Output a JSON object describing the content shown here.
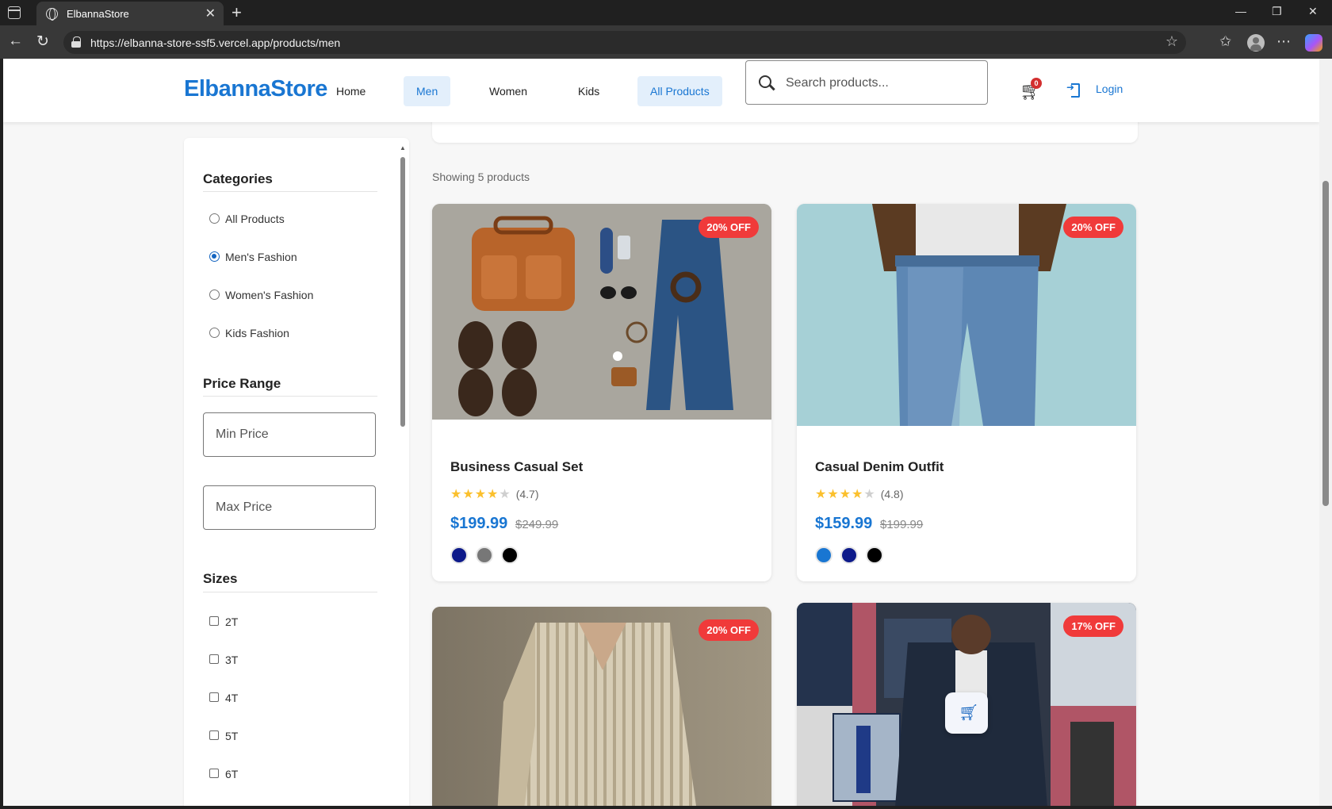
{
  "browser": {
    "tab_title": "ElbannaStore",
    "url": "https://elbanna-store-ssf5.vercel.app/products/men"
  },
  "header": {
    "brand": "ElbannaStore",
    "nav": [
      {
        "label": "Home",
        "active": false
      },
      {
        "label": "Men",
        "active": true
      },
      {
        "label": "Women",
        "active": false
      },
      {
        "label": "Kids",
        "active": false
      },
      {
        "label": "All Products",
        "active": true
      }
    ],
    "search_placeholder": "Search products...",
    "cart_count": "0",
    "login_label": "Login"
  },
  "filters": {
    "categories_title": "Categories",
    "categories": [
      {
        "label": "All Products",
        "selected": false
      },
      {
        "label": "Men's Fashion",
        "selected": true
      },
      {
        "label": "Women's Fashion",
        "selected": false
      },
      {
        "label": "Kids Fashion",
        "selected": false
      }
    ],
    "price_title": "Price Range",
    "min_placeholder": "Min Price",
    "max_placeholder": "Max Price",
    "sizes_title": "Sizes",
    "sizes": [
      "2T",
      "3T",
      "4T",
      "5T",
      "6T"
    ]
  },
  "results": {
    "showing_text": "Showing 5 products"
  },
  "products": [
    {
      "title": "Business Casual Set",
      "badge": "20% OFF",
      "rating": "(4.7)",
      "stars": 4,
      "price": "$199.99",
      "old_price": "$249.99",
      "colors": [
        "#0d1a8a",
        "#777777",
        "#000000"
      ]
    },
    {
      "title": "Casual Denim Outfit",
      "badge": "20% OFF",
      "rating": "(4.8)",
      "stars": 4,
      "price": "$159.99",
      "old_price": "$199.99",
      "colors": [
        "#1976d2",
        "#0d1a8a",
        "#000000"
      ]
    },
    {
      "badge": "20% OFF"
    },
    {
      "badge": "17% OFF"
    }
  ],
  "colors": {
    "accent": "#1976d2",
    "badge": "#f03a3a",
    "active_nav_bg": "#e3effb"
  }
}
